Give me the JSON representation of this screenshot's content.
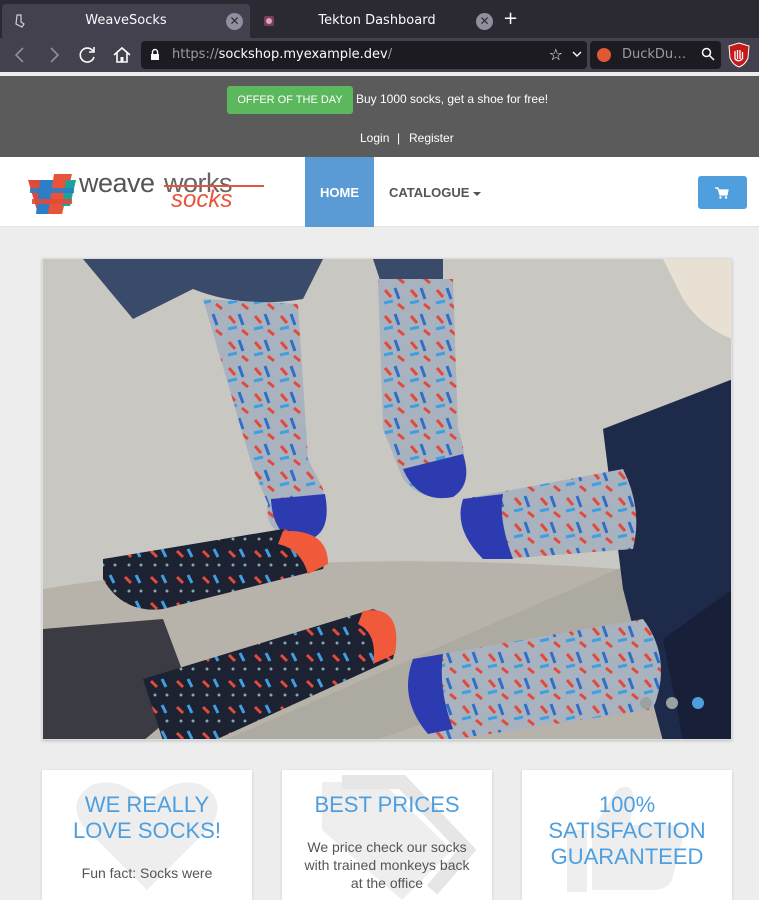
{
  "browser": {
    "tabs": [
      {
        "title": "WeaveSocks",
        "active": true
      },
      {
        "title": "Tekton Dashboard",
        "active": false
      }
    ],
    "url_scheme": "https://",
    "url_host": "sockshop.myexample.dev",
    "url_path": "/",
    "search_placeholder": "DuckDu…"
  },
  "offer": {
    "button_label": "OFFER OF THE DAY",
    "text": "Buy 1000 socks, get a shoe for free!"
  },
  "account": {
    "login": "Login",
    "separator": "|",
    "register": "Register"
  },
  "nav": {
    "logo_word1": "weave",
    "logo_word2": "works",
    "logo_word3": "socks",
    "home": "HOME",
    "catalogue": "CATALOGUE"
  },
  "carousel": {
    "slide_count": 3,
    "active_index": 2
  },
  "features": [
    {
      "title_line1": "WE REALLY",
      "title_line2": "LOVE SOCKS!",
      "title_line3": "",
      "text": "Fun fact: Socks were"
    },
    {
      "title_line1": "BEST PRICES",
      "title_line2": "",
      "title_line3": "",
      "text": "We price check our socks with trained monkeys back at the office"
    },
    {
      "title_line1": "100%",
      "title_line2": "SATISFACTION",
      "title_line3": "GUARANTEED",
      "text": ""
    }
  ],
  "colors": {
    "accent": "#4f9fdf",
    "offer_green": "#5cb85c",
    "offer_bar": "#5b5b5b"
  }
}
